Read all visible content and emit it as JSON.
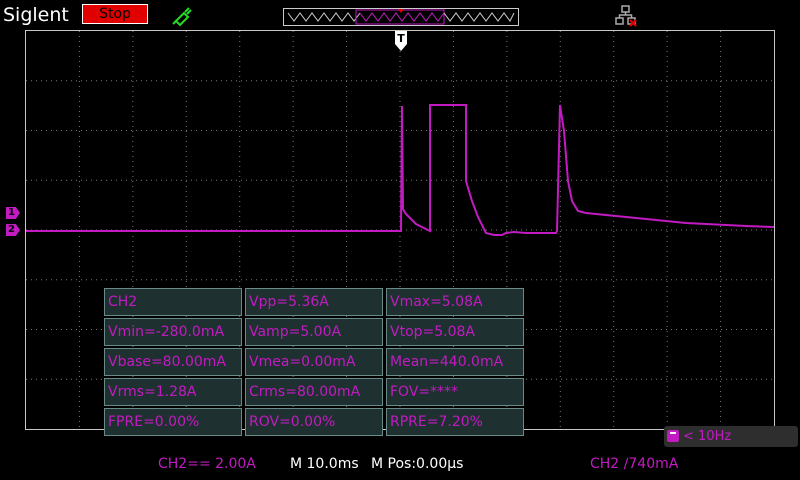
{
  "header": {
    "brand": "Siglent",
    "run_state": "Stop"
  },
  "channels": [
    {
      "marker": "1"
    },
    {
      "marker": "2"
    }
  ],
  "trigger_marker": "T",
  "measurements": [
    [
      "CH2",
      "Vpp=5.36A",
      "Vmax=5.08A"
    ],
    [
      "Vmin=-280.0mA",
      "Vamp=5.00A",
      "Vtop=5.08A"
    ],
    [
      "Vbase=80.00mA",
      "Vmea=0.00mA",
      "Mean=440.0mA"
    ],
    [
      "Vrms=1.28A",
      "Crms=80.00mA",
      "FOV=****"
    ],
    [
      "FPRE=0.00%",
      "ROV=0.00%",
      "RPRE=7.20%"
    ]
  ],
  "trigger_freq": "< 10Hz",
  "status_bar": {
    "ch2_scale": "CH2== 2.00A",
    "timebase": "M 10.0ms",
    "mpos": "M Pos:0.00µs",
    "trigger": "CH2 ∕740mA"
  },
  "colors": {
    "ch2": "#c21bc2",
    "stop": "#e00000",
    "probe": "#22dd22"
  },
  "icons": [
    "probe-icon",
    "network-icon",
    "trigger-icon"
  ]
}
